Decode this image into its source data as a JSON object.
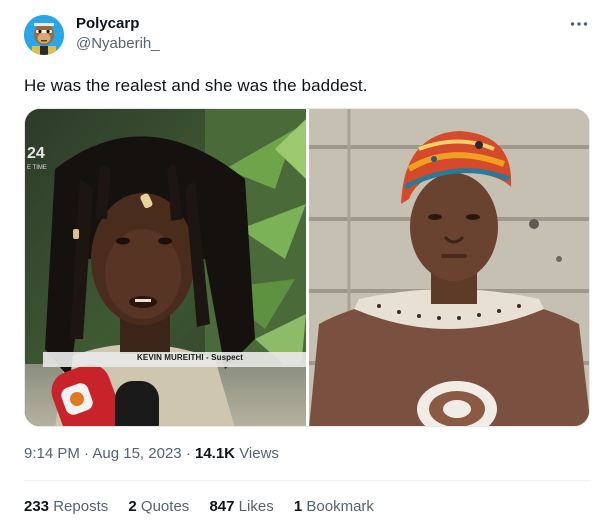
{
  "author": {
    "display_name": "Polycarp",
    "handle": "@Nyaberih_",
    "avatar_icon": "ape-nft-avatar-icon"
  },
  "more_icon": "more-horizontal-icon",
  "tweet": {
    "text": "He was the realest and she was the baddest."
  },
  "media": {
    "left_image": {
      "channel_number": "24",
      "channel_sub": "E TIME",
      "lower_third": "KEVIN MUREITHI - Suspect"
    },
    "right_image": {}
  },
  "meta": {
    "time": "9:14 PM",
    "date": "Aug 15, 2023",
    "views_count": "14.1K",
    "views_label": "Views"
  },
  "stats": {
    "reposts_count": "233",
    "reposts_label": "Reposts",
    "quotes_count": "2",
    "quotes_label": "Quotes",
    "likes_count": "847",
    "likes_label": "Likes",
    "bookmarks_count": "1",
    "bookmarks_label": "Bookmark"
  },
  "colors": {
    "text_primary": "#0f1419",
    "text_secondary": "#536471",
    "divider": "#eff3f4",
    "avatar_bg": "#2aa6e8"
  }
}
